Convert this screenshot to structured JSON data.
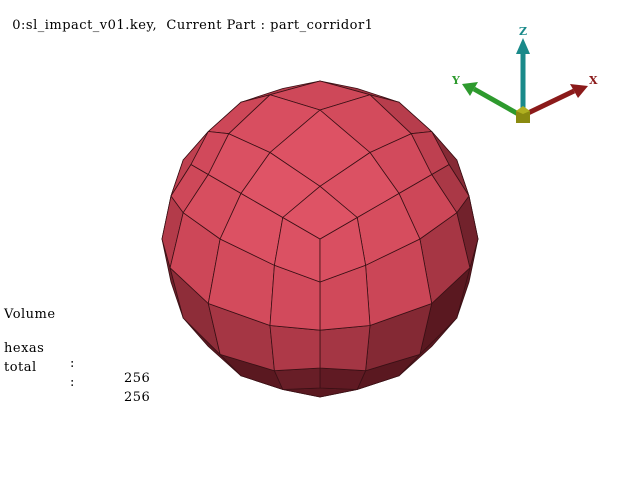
{
  "header": {
    "model_title": "0:sl_impact_v01.key,",
    "current_part_label": "Current Part :",
    "current_part_value": "part_corridor1"
  },
  "stats": {
    "section_title": "Volume",
    "rows": [
      {
        "label": "hexas",
        "separator": ":",
        "value": "256"
      },
      {
        "label": "total",
        "separator": ":",
        "value": "256"
      }
    ]
  },
  "axes": {
    "x": {
      "label": "X",
      "color": "#8b1a1a"
    },
    "y": {
      "label": "Y",
      "color": "#2e9a2e"
    },
    "z": {
      "label": "Z",
      "color": "#1a8a8a"
    },
    "origin_color": "#8a8a10"
  },
  "mesh": {
    "element_type": "hexas",
    "fill_color": "#c94455",
    "highlight_color": "#e05466",
    "shadow_color": "#5a1820",
    "edge_color": "#3a1015"
  }
}
